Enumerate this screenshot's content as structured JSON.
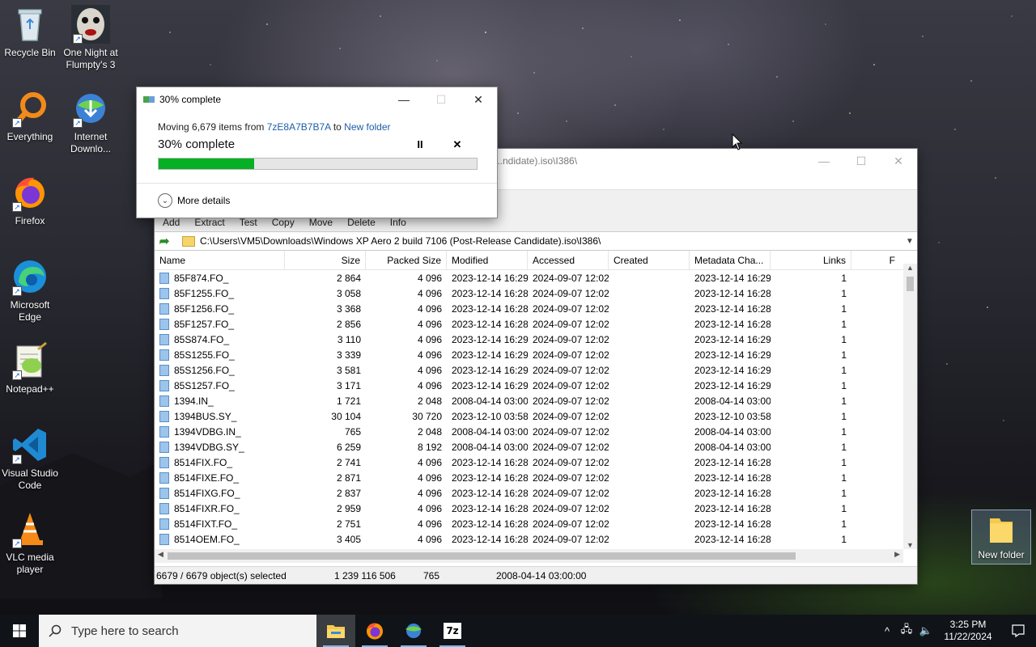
{
  "desktop": {
    "icons": [
      {
        "label": "Recycle Bin"
      },
      {
        "label": "One Night at Flumpty's 3"
      },
      {
        "label": "Everything"
      },
      {
        "label": "Internet Downlo..."
      },
      {
        "label": "Firefox"
      },
      {
        "label": "Microsoft Edge"
      },
      {
        "label": "Notepad++"
      },
      {
        "label": "Visual Studio Code"
      },
      {
        "label": "VLC media player"
      },
      {
        "label": "New folder"
      }
    ]
  },
  "progress_dialog": {
    "title": "30% complete",
    "moving_prefix": "Moving 6,679 items from",
    "source": "7zE8A7B7B7A",
    "to_word": "to",
    "destination": "New folder",
    "percent_text": "30% complete",
    "progress": 0.3,
    "pause_glyph": "II",
    "cancel_glyph": "✕",
    "more_details": "More details",
    "accent": "#06b025"
  },
  "file_manager": {
    "title": "...ndidate).iso\\I386\\",
    "toolbar": [
      "Add",
      "Extract",
      "Test",
      "Copy",
      "Move",
      "Delete",
      "Info"
    ],
    "path": "C:\\Users\\VM5\\Downloads\\Windows XP Aero 2 build 7106 (Post-Release Candidate).iso\\I386\\",
    "columns": [
      "Name",
      "Size",
      "Packed Size",
      "Modified",
      "Accessed",
      "Created",
      "Metadata Cha...",
      "Links",
      "F"
    ],
    "rows": [
      [
        "85F874.FO_",
        "2 864",
        "4 096",
        "2023-12-14 16:29",
        "2024-09-07 12:02",
        "",
        "2023-12-14 16:29",
        "1"
      ],
      [
        "85F1255.FO_",
        "3 058",
        "4 096",
        "2023-12-14 16:28",
        "2024-09-07 12:02",
        "",
        "2023-12-14 16:28",
        "1"
      ],
      [
        "85F1256.FO_",
        "3 368",
        "4 096",
        "2023-12-14 16:28",
        "2024-09-07 12:02",
        "",
        "2023-12-14 16:28",
        "1"
      ],
      [
        "85F1257.FO_",
        "2 856",
        "4 096",
        "2023-12-14 16:28",
        "2024-09-07 12:02",
        "",
        "2023-12-14 16:28",
        "1"
      ],
      [
        "85S874.FO_",
        "3 110",
        "4 096",
        "2023-12-14 16:29",
        "2024-09-07 12:02",
        "",
        "2023-12-14 16:29",
        "1"
      ],
      [
        "85S1255.FO_",
        "3 339",
        "4 096",
        "2023-12-14 16:29",
        "2024-09-07 12:02",
        "",
        "2023-12-14 16:29",
        "1"
      ],
      [
        "85S1256.FO_",
        "3 581",
        "4 096",
        "2023-12-14 16:29",
        "2024-09-07 12:02",
        "",
        "2023-12-14 16:29",
        "1"
      ],
      [
        "85S1257.FO_",
        "3 171",
        "4 096",
        "2023-12-14 16:29",
        "2024-09-07 12:02",
        "",
        "2023-12-14 16:29",
        "1"
      ],
      [
        "1394.IN_",
        "1 721",
        "2 048",
        "2008-04-14 03:00",
        "2024-09-07 12:02",
        "",
        "2008-04-14 03:00",
        "1"
      ],
      [
        "1394BUS.SY_",
        "30 104",
        "30 720",
        "2023-12-10 03:58",
        "2024-09-07 12:02",
        "",
        "2023-12-10 03:58",
        "1"
      ],
      [
        "1394VDBG.IN_",
        "765",
        "2 048",
        "2008-04-14 03:00",
        "2024-09-07 12:02",
        "",
        "2008-04-14 03:00",
        "1"
      ],
      [
        "1394VDBG.SY_",
        "6 259",
        "8 192",
        "2008-04-14 03:00",
        "2024-09-07 12:02",
        "",
        "2008-04-14 03:00",
        "1"
      ],
      [
        "8514FIX.FO_",
        "2 741",
        "4 096",
        "2023-12-14 16:28",
        "2024-09-07 12:02",
        "",
        "2023-12-14 16:28",
        "1"
      ],
      [
        "8514FIXE.FO_",
        "2 871",
        "4 096",
        "2023-12-14 16:28",
        "2024-09-07 12:02",
        "",
        "2023-12-14 16:28",
        "1"
      ],
      [
        "8514FIXG.FO_",
        "2 837",
        "4 096",
        "2023-12-14 16:28",
        "2024-09-07 12:02",
        "",
        "2023-12-14 16:28",
        "1"
      ],
      [
        "8514FIXR.FO_",
        "2 959",
        "4 096",
        "2023-12-14 16:28",
        "2024-09-07 12:02",
        "",
        "2023-12-14 16:28",
        "1"
      ],
      [
        "8514FIXT.FO_",
        "2 751",
        "4 096",
        "2023-12-14 16:28",
        "2024-09-07 12:02",
        "",
        "2023-12-14 16:28",
        "1"
      ],
      [
        "8514OEM.FO_",
        "3 405",
        "4 096",
        "2023-12-14 16:28",
        "2024-09-07 12:02",
        "",
        "2023-12-14 16:28",
        "1"
      ]
    ],
    "status": {
      "selected": "6679 / 6679 object(s) selected",
      "total_size": "1 239 116 506",
      "item_size": "765",
      "modified": "2008-04-14 03:00:00"
    }
  },
  "taskbar": {
    "search_placeholder": "Type here to search",
    "apps": [
      "file-explorer-icon",
      "firefox-icon",
      "internet-download-manager-icon",
      "7zip-icon"
    ],
    "sevenzip_label": "7z",
    "time": "3:25 PM",
    "date": "11/22/2024"
  }
}
